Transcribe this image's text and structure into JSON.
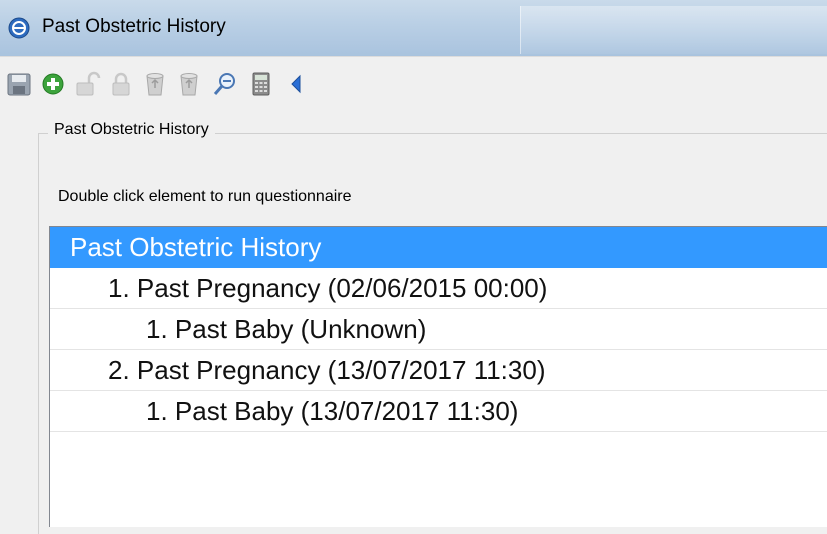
{
  "window": {
    "title": "Past Obstetric History"
  },
  "toolbar": {
    "buttons": [
      {
        "name": "save",
        "icon": "floppy-disk-icon"
      },
      {
        "name": "add",
        "icon": "green-plus-circle-icon"
      },
      {
        "name": "unlock",
        "icon": "unlocked-padlock-icon"
      },
      {
        "name": "lock",
        "icon": "locked-padlock-icon"
      },
      {
        "name": "delete",
        "icon": "recycle-bin-icon"
      },
      {
        "name": "delete-all",
        "icon": "recycle-bin-icon"
      },
      {
        "name": "search",
        "icon": "magnifier-icon"
      },
      {
        "name": "calculator",
        "icon": "calculator-icon"
      },
      {
        "name": "back",
        "icon": "blue-left-triangle-icon"
      }
    ]
  },
  "group": {
    "legend": "Past Obstetric History",
    "hint": "Double click element to run questionnaire"
  },
  "tree": {
    "items": [
      {
        "label": "Past Obstetric History",
        "level": 0,
        "selected": true
      },
      {
        "label": "1. Past Pregnancy (02/06/2015 00:00)",
        "level": 1,
        "selected": false
      },
      {
        "label": "1. Past Baby (Unknown)",
        "level": 2,
        "selected": false
      },
      {
        "label": "2. Past Pregnancy (13/07/2017 11:30)",
        "level": 1,
        "selected": false
      },
      {
        "label": "1. Past Baby (13/07/2017 11:30)",
        "level": 2,
        "selected": false
      }
    ]
  },
  "colors": {
    "selection": "#3399ff",
    "titlebar": "#b9cfe5",
    "add_icon_green": "#3ca33c",
    "back_icon_blue": "#2a6fd6"
  }
}
